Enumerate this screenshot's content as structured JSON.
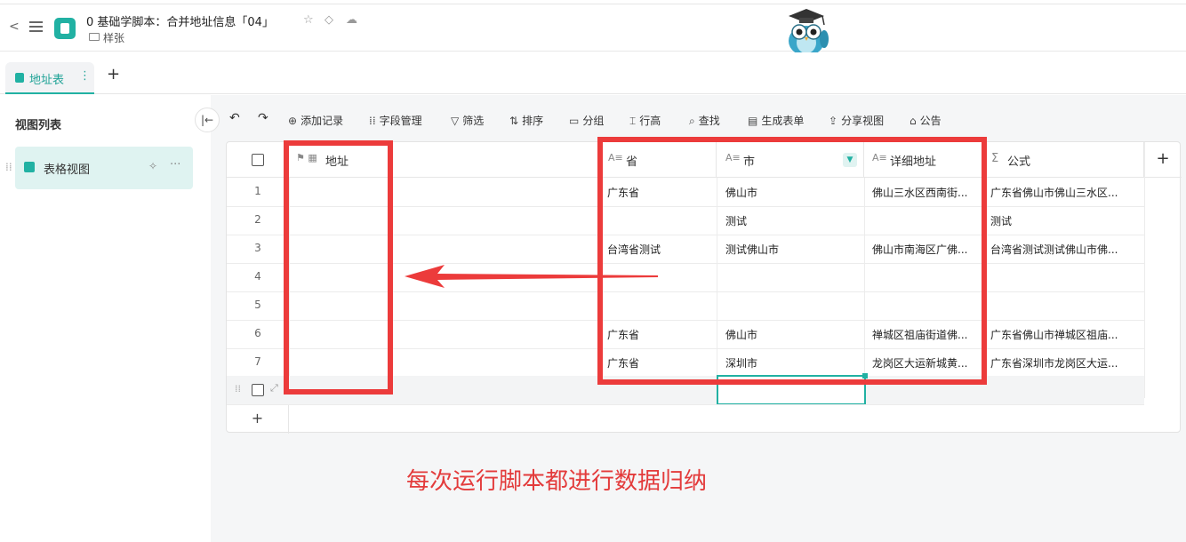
{
  "header": {
    "title": "0 基础学脚本：合并地址信息「04」",
    "folder": "样张"
  },
  "tabs": [
    {
      "label": "地址表",
      "more": "⋮"
    }
  ],
  "tab_add": "+",
  "left_panel": {
    "title": "视图列表",
    "views": [
      {
        "label": "表格视图"
      }
    ]
  },
  "toolbar": {
    "undo": "↶",
    "redo": "↷",
    "items": [
      {
        "icon": "⊕",
        "label": "添加记录"
      },
      {
        "icon": "⁞⁞",
        "label": "字段管理"
      },
      {
        "icon": "▽",
        "label": "筛选"
      },
      {
        "icon": "⇅",
        "label": "排序"
      },
      {
        "icon": "▭",
        "label": "分组"
      },
      {
        "icon": "⌶",
        "label": "行高"
      },
      {
        "icon": "⌕",
        "label": "查找"
      },
      {
        "icon": "▤",
        "label": "生成表单"
      },
      {
        "icon": "⇪",
        "label": "分享视图"
      },
      {
        "icon": "⌂",
        "label": "公告"
      }
    ]
  },
  "table": {
    "columns": [
      {
        "icon": "⚑ ▦",
        "label": "地址"
      },
      {
        "icon": "A≡",
        "label": "省"
      },
      {
        "icon": "A≡",
        "label": "市",
        "filter": "▼"
      },
      {
        "icon": "A≡",
        "label": "详细地址"
      },
      {
        "icon": "Σ",
        "label": "公式"
      }
    ],
    "add_column": "+",
    "rows": [
      {
        "num": "1",
        "address": "",
        "province": "广东省",
        "city": "佛山市",
        "detail": "佛山三水区西南街...",
        "formula": "广东省佛山市佛山三水区..."
      },
      {
        "num": "2",
        "address": "",
        "province": "",
        "city": "测试",
        "detail": "",
        "formula": "测试"
      },
      {
        "num": "3",
        "address": "",
        "province": "台湾省测试",
        "city": "测试佛山市",
        "detail": "佛山市南海区广佛...",
        "formula": "台湾省测试测试佛山市佛..."
      },
      {
        "num": "4",
        "address": "",
        "province": "",
        "city": "",
        "detail": "",
        "formula": ""
      },
      {
        "num": "5",
        "address": "",
        "province": "",
        "city": "",
        "detail": "",
        "formula": ""
      },
      {
        "num": "6",
        "address": "",
        "province": "广东省",
        "city": "佛山市",
        "detail": "禅城区祖庙街道佛...",
        "formula": "广东省佛山市禅城区祖庙..."
      },
      {
        "num": "7",
        "address": "",
        "province": "广东省",
        "city": "深圳市",
        "detail": "龙岗区大运新城黄...",
        "formula": "广东省深圳市龙岗区大运..."
      }
    ],
    "add_row": "+"
  },
  "annotation": {
    "caption": "每次运行脚本都进行数据归纳",
    "color": "#ec3b3b"
  }
}
